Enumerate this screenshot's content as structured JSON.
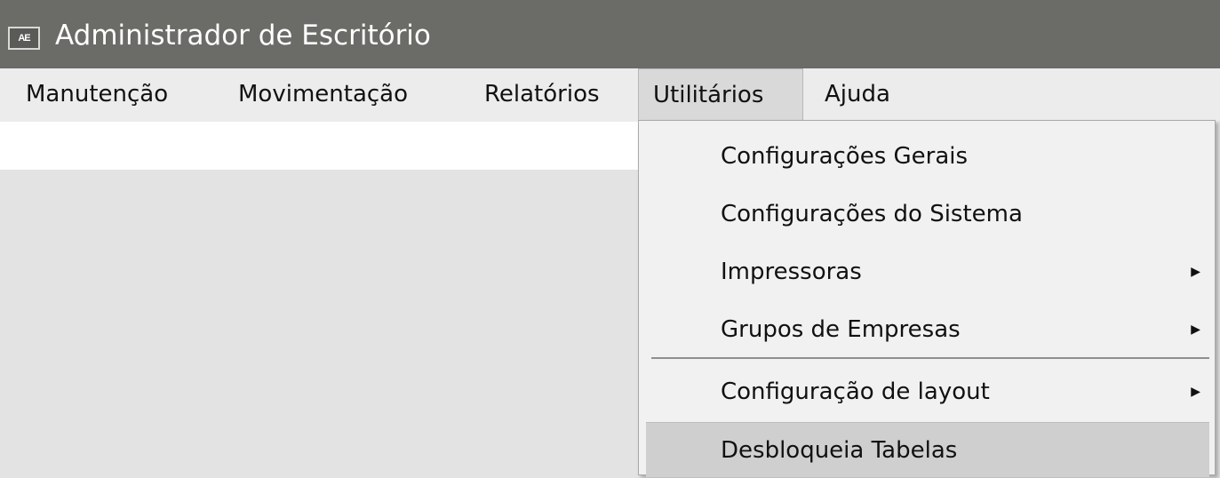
{
  "window": {
    "title": "Administrador de Escritório",
    "icon_text": "AE",
    "icon_name": "app-icon"
  },
  "menubar": {
    "items": [
      {
        "label": "Manutenção"
      },
      {
        "label": "Movimentação"
      },
      {
        "label": "Relatórios"
      },
      {
        "label": "Utilitários",
        "active": true
      },
      {
        "label": "Ajuda"
      }
    ]
  },
  "dropdown": {
    "items": [
      {
        "label": "Configurações Gerais",
        "has_submenu": false
      },
      {
        "label": "Configurações do Sistema",
        "has_submenu": false
      },
      {
        "label": "Impressoras",
        "has_submenu": true
      },
      {
        "label": "Grupos de Empresas",
        "has_submenu": true
      },
      {
        "label": "Configuração de layout",
        "has_submenu": true
      },
      {
        "label": "Desbloqueia Tabelas",
        "has_submenu": false,
        "highlighted": true
      }
    ],
    "submenu_arrow": "▶"
  },
  "colors": {
    "titlebar": "#6b6b67",
    "menubar": "#ececec",
    "client_area": "#e3e3e3",
    "dropdown_bg": "#f1f1f1",
    "highlight": "#cfcfcf"
  }
}
